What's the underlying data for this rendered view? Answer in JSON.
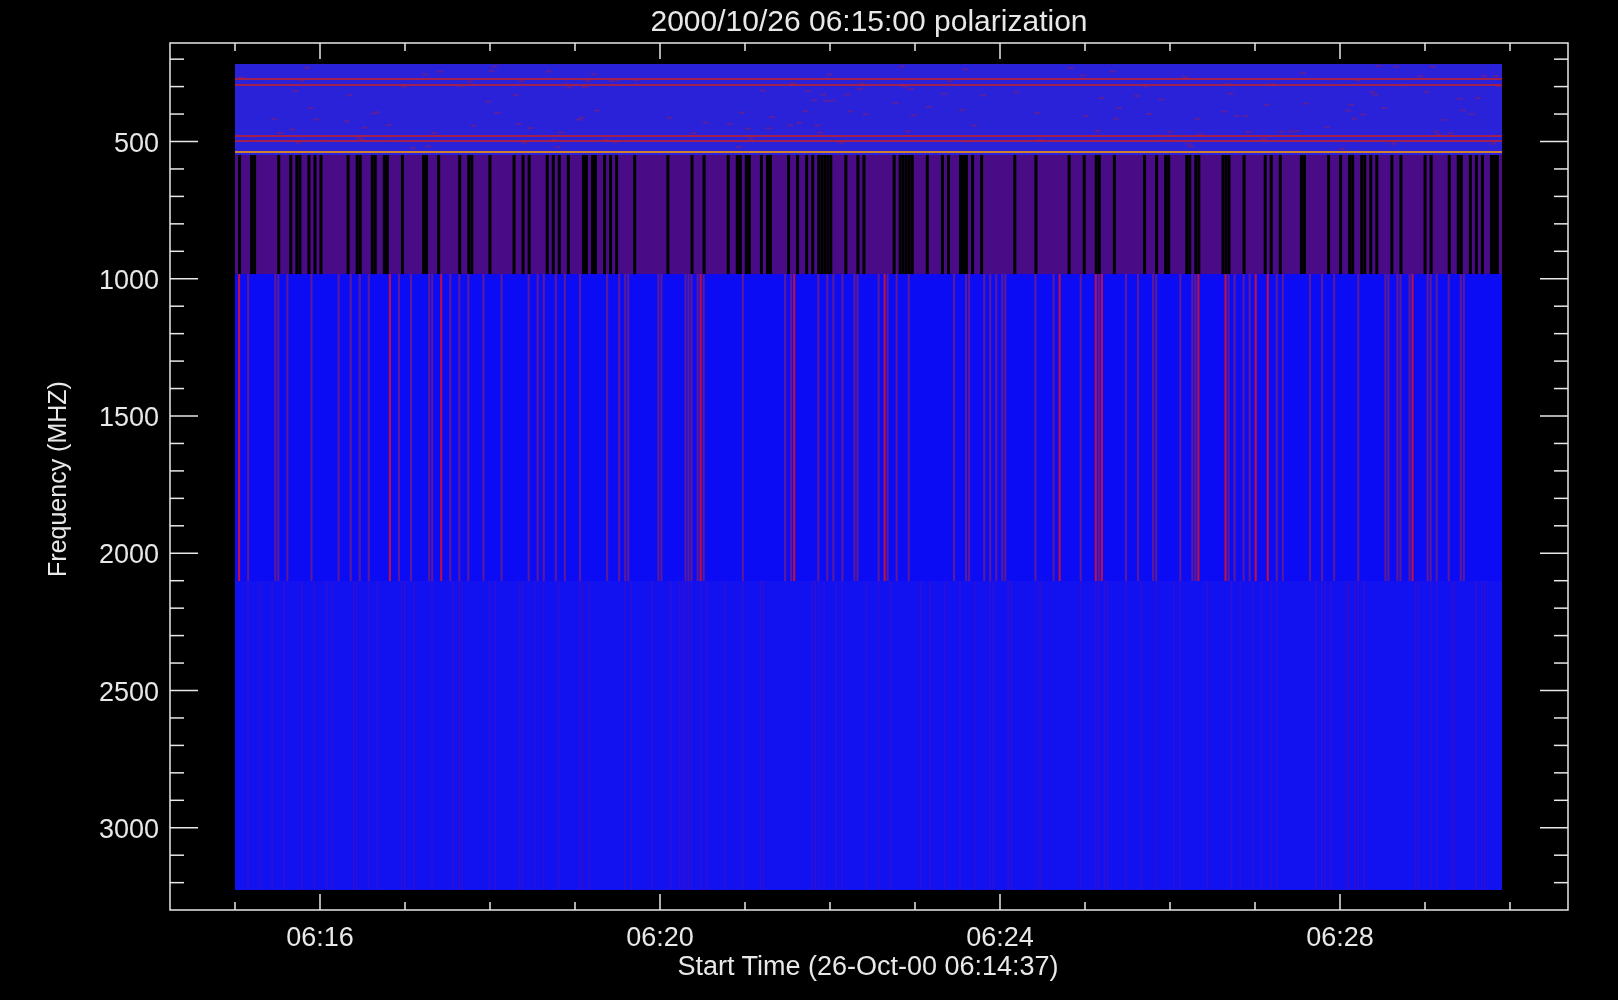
{
  "title": "2000/10/26 06:15:00 polarization",
  "xlabel": "Start Time (26-Oct-00 06:14:37)",
  "ylabel": "Frequency (MHZ)",
  "xticks": [
    "06:16",
    "06:20",
    "06:24",
    "06:28"
  ],
  "yticks": [
    "500",
    "1000",
    "1500",
    "2000",
    "2500",
    "3000"
  ]
}
